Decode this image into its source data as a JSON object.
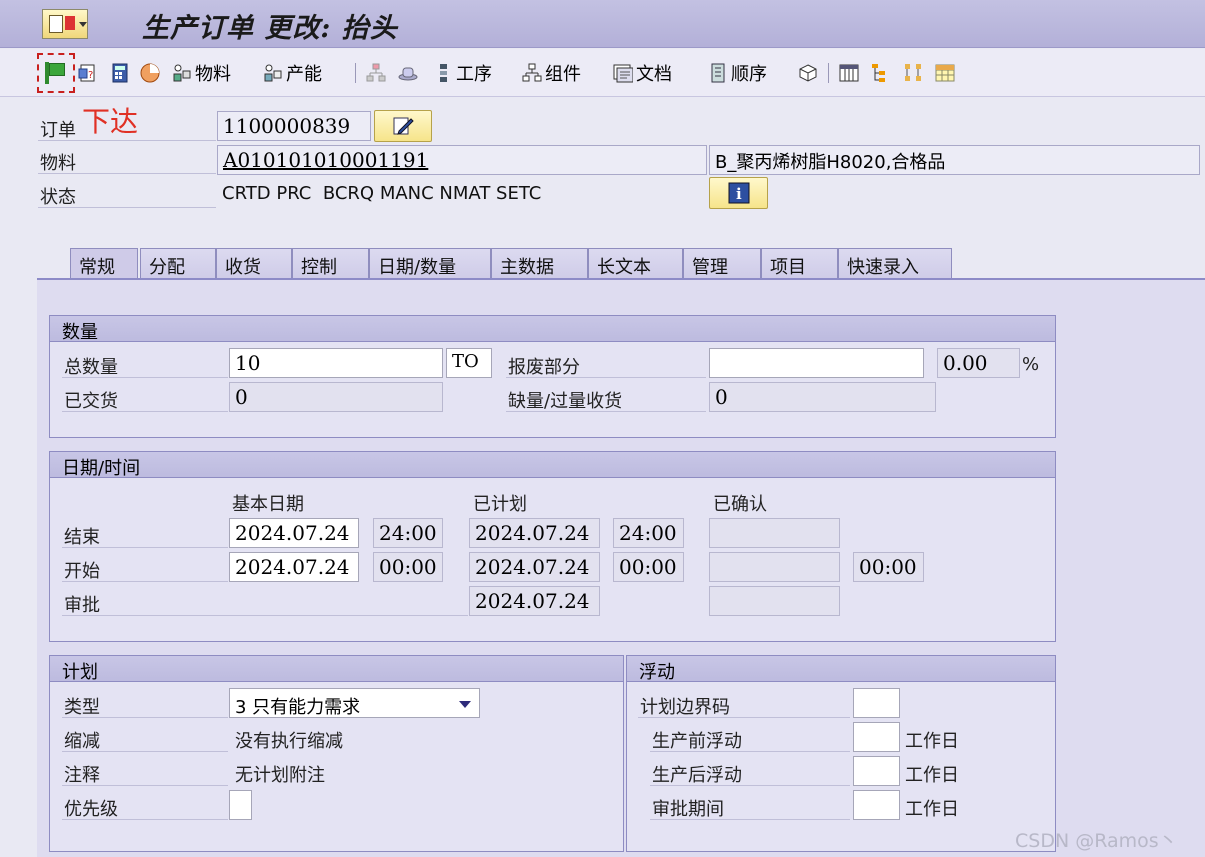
{
  "window": {
    "title": "生产订单 更改: 抬头"
  },
  "toolbar": {
    "items": [
      {
        "icon": "release-flag-icon",
        "label": ""
      },
      {
        "icon": "document-question-icon",
        "label": ""
      },
      {
        "icon": "calculator-icon",
        "label": ""
      },
      {
        "icon": "pie-chart-icon",
        "label": ""
      },
      {
        "icon": "material-icon",
        "label": "物料"
      },
      {
        "icon": "capacity-icon",
        "label": "产能"
      },
      {
        "icon": "hierarchy-icon",
        "label": ""
      },
      {
        "icon": "hat-icon",
        "label": ""
      },
      {
        "icon": "operations-icon",
        "label": "工序"
      },
      {
        "icon": "components-icon",
        "label": "组件"
      },
      {
        "icon": "documents-icon",
        "label": "文档"
      },
      {
        "icon": "sequence-icon",
        "label": "顺序"
      },
      {
        "icon": "cube-icon",
        "label": ""
      },
      {
        "icon": "columns-icon",
        "label": ""
      },
      {
        "icon": "tree-icon",
        "label": ""
      },
      {
        "icon": "network-icon",
        "label": ""
      },
      {
        "icon": "grid-icon",
        "label": ""
      }
    ]
  },
  "annotation": "下达",
  "header": {
    "order_label": "订单",
    "order_value": "1100000839",
    "material_label": "物料",
    "material_value": "A010101010001191",
    "material_desc": "B_聚丙烯树脂H8020,合格品",
    "status_label": "状态",
    "status_value": "CRTD PRC  BCRQ MANC NMAT SETC"
  },
  "tabs": [
    "常规",
    "分配",
    "收货",
    "控制",
    "日期/数量",
    "主数据",
    "长文本",
    "管理",
    "项目",
    "快速录入"
  ],
  "quantity": {
    "title": "数量",
    "total_label": "总数量",
    "total_value": "10",
    "unit": "TO",
    "scrap_label": "报废部分",
    "scrap_value": "",
    "scrap_pct": "0.00",
    "pct_sign": "%",
    "delivered_label": "已交货",
    "delivered_value": "0",
    "short_label": "缺量/过量收货",
    "short_value": "0"
  },
  "dates": {
    "title": "日期/时间",
    "col_basic": "基本日期",
    "col_sched": "已计划",
    "col_confirmed": "已确认",
    "end_label": "结束",
    "start_label": "开始",
    "release_label": "审批",
    "end_basic_date": "2024.07.24",
    "end_basic_time": "24:00",
    "end_sched_date": "2024.07.24",
    "end_sched_time": "24:00",
    "end_conf": "",
    "start_basic_date": "2024.07.24",
    "start_basic_time": "00:00",
    "start_sched_date": "2024.07.24",
    "start_sched_time": "00:00",
    "start_conf": "",
    "start_conf_time": "00:00",
    "release_sched_date": "2024.07.24",
    "release_conf": ""
  },
  "plan": {
    "title": "计划",
    "type_label": "类型",
    "type_value": "3 只有能力需求",
    "reduction_label": "缩减",
    "reduction_value": "没有执行缩减",
    "note_label": "注释",
    "note_value": "无计划附注",
    "priority_label": "优先级",
    "priority_value": ""
  },
  "float": {
    "title": "浮动",
    "sm_key_label": "计划边界码",
    "sm_key_value": "",
    "before_label": "生产前浮动",
    "before_value": "",
    "after_label": "生产后浮动",
    "after_value": "",
    "release_label": "审批期间",
    "release_value": "",
    "unit": "工作日"
  },
  "watermark": "CSDN @Ramos丶"
}
